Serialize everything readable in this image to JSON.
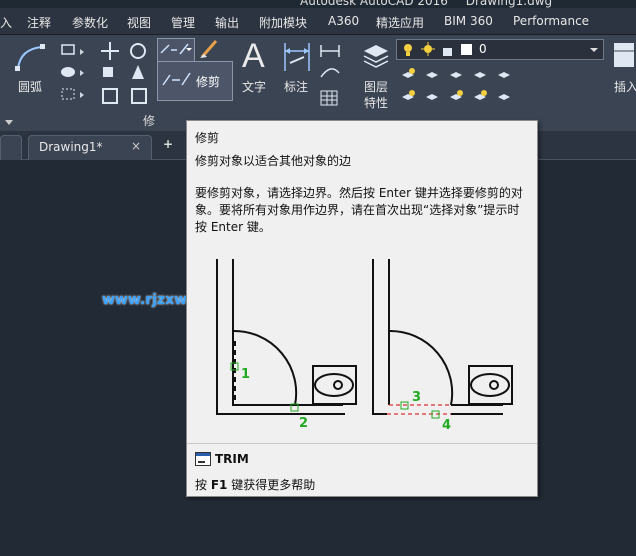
{
  "titlebar": {
    "app": "Autodesk AutoCAD 2016",
    "file": "Drawing1.dwg"
  },
  "menu": {
    "items": [
      "入",
      "注释",
      "参数化",
      "视图",
      "管理",
      "输出",
      "附加模块",
      "A360",
      "精选应用",
      "BIM 360",
      "Performance"
    ]
  },
  "ribbon": {
    "arc_label": "圆弧",
    "trim_label": "修剪",
    "modify_panel": "修",
    "text_label": "文字",
    "dimension_label": "标注",
    "layer_props_label": "图层\n特性",
    "layer_props_line1": "图层",
    "layer_props_line2": "特性",
    "layer_value": "0",
    "insert_label": "插入"
  },
  "tabs": {
    "doc_tab_label": "Drawing1*",
    "close_glyph": "×",
    "add_glyph": "+"
  },
  "watermark": "www.rjzxw.com",
  "tooltip": {
    "title": "修剪",
    "short_desc": "修剪对象以适合其他对象的边",
    "long_desc_line1": "要修剪对象，请选择边界。然后按 Enter 键并选择要修剪的对",
    "long_desc_line2": "象。要将所有对象用作边界，请在首次出现“选择对象”提示时",
    "long_desc_line3": "按 Enter 键。",
    "markers": [
      "1",
      "2",
      "3",
      "4"
    ],
    "command": "TRIM",
    "help_prefix": "按 ",
    "help_key": "F1",
    "help_suffix": " 键获得更多帮助"
  },
  "colors": {
    "canvas": "#222a35",
    "ribbon": "#3b4453",
    "marker_green": "#22aa22",
    "dashed_red": "#e05050",
    "watermark_blue": "#3aa2ff"
  }
}
